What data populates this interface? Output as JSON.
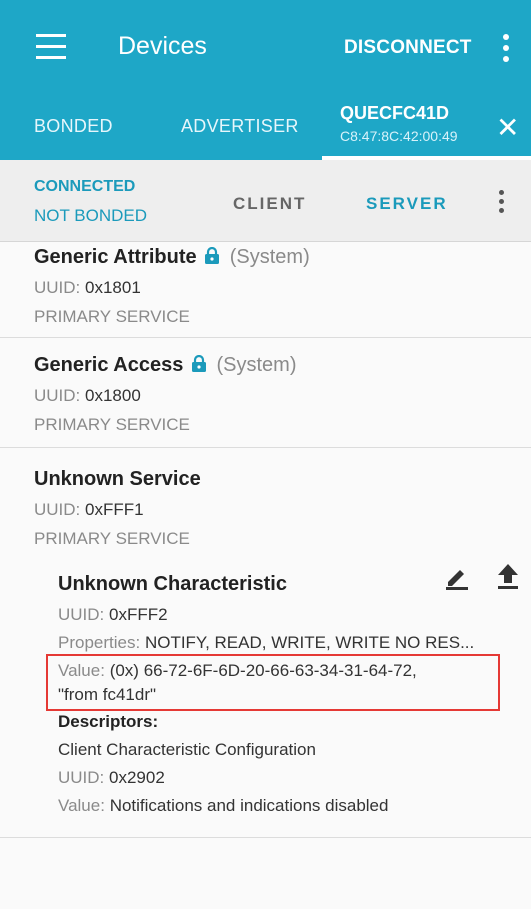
{
  "appbar": {
    "title": "Devices",
    "disconnect_label": "DISCONNECT",
    "tabs": [
      "BONDED",
      "ADVERTISER"
    ],
    "device": {
      "name": "QUECFC41D",
      "mac": "C8:47:8C:42:00:49"
    }
  },
  "connection": {
    "status": "CONNECTED",
    "bond_status": "NOT BONDED",
    "tabs": [
      "CLIENT",
      "SERVER"
    ],
    "active_tab": "SERVER"
  },
  "services": [
    {
      "name": "Generic Attribute",
      "suffix": "(System)",
      "uuid_label": "UUID:",
      "uuid": "0x1801",
      "type": "PRIMARY SERVICE"
    },
    {
      "name": "Generic Access",
      "suffix": "(System)",
      "uuid_label": "UUID:",
      "uuid": "0x1800",
      "type": "PRIMARY SERVICE"
    },
    {
      "name": "Unknown Service",
      "uuid_label": "UUID:",
      "uuid": "0xFFF1",
      "type": "PRIMARY SERVICE"
    }
  ],
  "characteristic": {
    "name": "Unknown Characteristic",
    "uuid_label": "UUID:",
    "uuid": "0xFFF2",
    "properties_label": "Properties:",
    "properties": "NOTIFY, READ, WRITE, WRITE NO RES...",
    "value_label": "Value:",
    "value_line1": "(0x) 66-72-6F-6D-20-66-63-34-31-64-72,",
    "value_line2": "\"from fc41dr\"",
    "descriptors_label": "Descriptors:",
    "descriptor": {
      "name": "Client Characteristic Configuration",
      "uuid_label": "UUID:",
      "uuid": "0x2902",
      "value_label": "Value:",
      "value": "Notifications and indications disabled"
    }
  },
  "colors": {
    "primary": "#1ea7c7",
    "accent": "#1b9abb",
    "highlight": "#e53935"
  },
  "icons": [
    "menu-icon",
    "more-vert-icon",
    "close-icon",
    "lock-icon",
    "edit-icon",
    "upload-icon"
  ]
}
